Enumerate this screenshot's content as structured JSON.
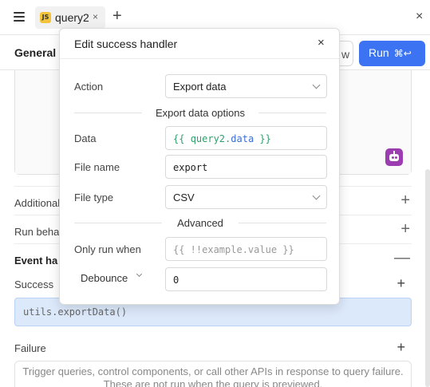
{
  "tab": {
    "badge": "JS",
    "label": "query2",
    "close": "×",
    "add": "+"
  },
  "window": {
    "close": "×"
  },
  "toolbar": {
    "general_label": "General",
    "ghost_button_text": "w",
    "run_label": "Run",
    "run_shortcut": "⌘↩"
  },
  "sections": {
    "additional": "Additional",
    "run_behavior": "Run beha",
    "event_handlers": "Event ha",
    "success": "Success",
    "failure": "Failure",
    "plus": "+",
    "minus": "—"
  },
  "success_handler_item": "utils.exportData()",
  "failure_empty_text": "Trigger queries, control components, or call other APIs in response to query failure. These are not run when the query is previewed.",
  "modal": {
    "title": "Edit success handler",
    "close": "×",
    "action_label": "Action",
    "action_value": "Export data",
    "options_heading": "Export data options",
    "data_label": "Data",
    "data_value_open": "{{",
    "data_value_obj": "query2",
    "data_value_dot": ".",
    "data_value_prop": "data",
    "data_value_close": "}}",
    "file_name_label": "File name",
    "file_name_value": "export",
    "file_type_label": "File type",
    "file_type_value": "CSV",
    "advanced_heading": "Advanced",
    "only_run_when_label": "Only run when",
    "only_run_when_placeholder": "{{ !!example.value }}",
    "debounce_label": "Debounce",
    "debounce_value": "0"
  },
  "colors": {
    "accent": "#3b73f3",
    "selected_item_bg": "#dce9fb",
    "ai_icon": "#9b3cb0",
    "js_badge": "#f3c33a"
  }
}
